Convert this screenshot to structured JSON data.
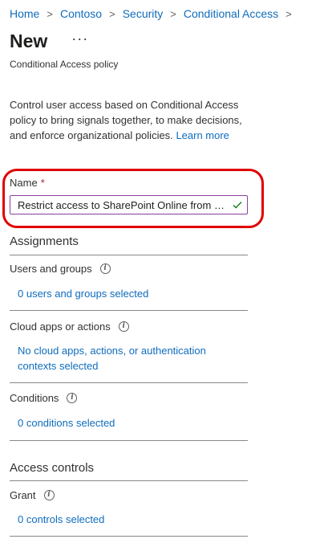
{
  "breadcrumb": [
    "Home",
    "Contoso",
    "Security",
    "Conditional Access"
  ],
  "breadcrumb_separator": ">",
  "page": {
    "title": "New",
    "more_label": "···",
    "subtitle": "Conditional Access policy"
  },
  "description": {
    "text": "Control user access based on Conditional Access policy to bring signals together, to make decisions, and enforce organizational policies.",
    "learn_more": "Learn more"
  },
  "name_field": {
    "label": "Name",
    "required_mark": "*",
    "value": "Restrict access to SharePoint Online from unmanaged devices",
    "valid_icon": "checkmark-icon"
  },
  "assignments": {
    "heading": "Assignments",
    "users": {
      "label": "Users and groups",
      "value": "0 users and groups selected"
    },
    "cloud_apps": {
      "label": "Cloud apps or actions",
      "value_line1": "No cloud apps, actions, or authentication",
      "value_line2": "contexts selected"
    },
    "conditions": {
      "label": "Conditions",
      "value": "0 conditions selected"
    }
  },
  "access_controls": {
    "heading": "Access controls",
    "grant": {
      "label": "Grant",
      "value": "0 controls selected"
    }
  },
  "colors": {
    "link": "#0f6cbd",
    "highlight": "#e00000",
    "required": "#a4262c",
    "valid": "#107c10"
  }
}
